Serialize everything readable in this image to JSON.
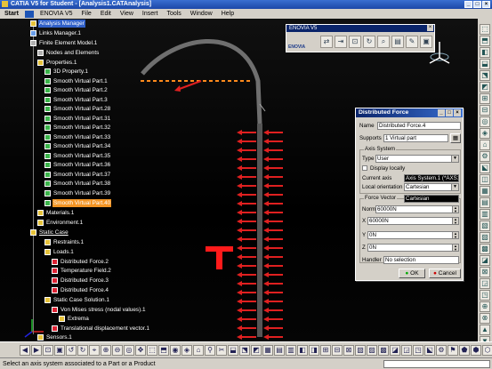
{
  "window": {
    "title": "CATIA V5 for Student - [Analysis1.CATAnalysis]",
    "buttons": [
      "_",
      "□",
      "×"
    ]
  },
  "menu": [
    "Start",
    "ENOVIA V5",
    "File",
    "Edit",
    "View",
    "Insert",
    "Tools",
    "Window",
    "Help"
  ],
  "tree": [
    {
      "label": "Analysis Manager",
      "state": "selected"
    },
    {
      "label": "Links Manager.1"
    },
    {
      "label": "Finite Element Model.1"
    },
    {
      "label": "Nodes and Elements"
    },
    {
      "label": "Properties.1"
    },
    {
      "label": "3D Property.1"
    },
    {
      "label": "Smooth Virtual Part.1"
    },
    {
      "label": "Smooth Virtual Part.2"
    },
    {
      "label": "Smooth Virtual Part.3"
    },
    {
      "label": "Smooth Virtual Part.28"
    },
    {
      "label": "Smooth Virtual Part.31"
    },
    {
      "label": "Smooth Virtual Part.32"
    },
    {
      "label": "Smooth Virtual Part.33"
    },
    {
      "label": "Smooth Virtual Part.34"
    },
    {
      "label": "Smooth Virtual Part.35"
    },
    {
      "label": "Smooth Virtual Part.36"
    },
    {
      "label": "Smooth Virtual Part.37"
    },
    {
      "label": "Smooth Virtual Part.38"
    },
    {
      "label": "Smooth Virtual Part.39"
    },
    {
      "label": "Smooth Virtual Part.40",
      "state": "highlighted"
    },
    {
      "label": "Materials.1"
    },
    {
      "label": "Environment.1"
    },
    {
      "label": "Static Case",
      "state": "underlined"
    },
    {
      "label": "Restraints.1"
    },
    {
      "label": "Loads.1"
    },
    {
      "label": "Distributed Force.2"
    },
    {
      "label": "Temperature Field.2"
    },
    {
      "label": "Distributed Force.3"
    },
    {
      "label": "Distributed Force.4"
    },
    {
      "label": "Static Case Solution.1"
    },
    {
      "label": "Von Mises stress (nodal values).1"
    },
    {
      "label": "Extrema"
    },
    {
      "label": "Translational displacement vector.1"
    },
    {
      "label": "Sensors.1"
    }
  ],
  "enovia_toolbar": {
    "title": "ENOVIA V5",
    "logo": "ENOVIA"
  },
  "dialog": {
    "title": "Distributed Force",
    "name_label": "Name",
    "name_value": "Distributed Force.4",
    "supports_label": "Supports",
    "supports_value": "1 Virtual part",
    "axis_group": "Axis System",
    "type_label": "Type",
    "type_value": "User",
    "display_locally": "Display locally",
    "current_axis_label": "Current axis",
    "current_axis_value": "Axis System.1 (*AXS1",
    "local_orientation_label": "Local orientation",
    "local_orientation_value": "Cartesian",
    "force_group": "Force Vector",
    "force_type_value": "Cartesian",
    "norm_label": "Norm",
    "norm_value": "60000N",
    "x_label": "X",
    "x_value": "60000N",
    "y_label": "Y",
    "y_value": "0N",
    "z_label": "Z",
    "z_value": "0N",
    "handler_label": "Handler",
    "handler_value": "No selection",
    "ok_label": "OK",
    "cancel_label": "Cancel"
  },
  "viewport": {
    "marker_letter": "T",
    "arrow_color": "#e02020",
    "marker_color": "#ff1a1a"
  },
  "status": {
    "text": "Select an axis system associated to a Part or a Product"
  }
}
